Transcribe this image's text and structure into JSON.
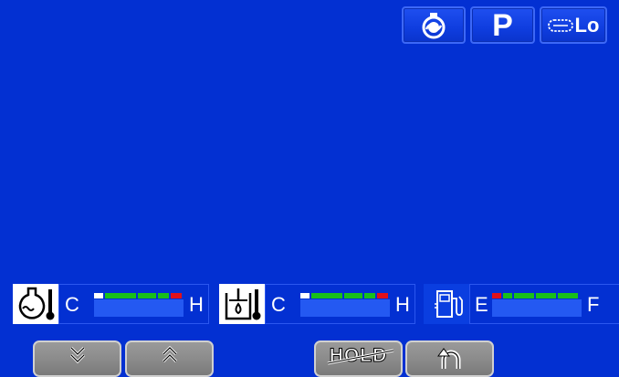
{
  "top_buttons": {
    "engine_icon": "engine-icon",
    "parking_label": "P",
    "track_speed_label": "Lo",
    "track_icon": "track-icon"
  },
  "gauges": [
    {
      "id": "coolant-temp",
      "icon": "coolant-temperature-icon",
      "low_label": "C",
      "high_label": "H",
      "level": 0
    },
    {
      "id": "hydraulic-oil-temp",
      "icon": "hydraulic-oil-temperature-icon",
      "low_label": "C",
      "high_label": "H",
      "level": 0
    },
    {
      "id": "fuel",
      "icon": "fuel-pump-icon",
      "low_label": "E",
      "high_label": "F",
      "level": 0
    }
  ],
  "colors": {
    "background": "#0330d2",
    "segment_white": "#ffffff",
    "segment_green": "#18c01a",
    "segment_red": "#e0101a"
  },
  "bottom_buttons": {
    "scroll_down_icon": "double-chevron-down-icon",
    "scroll_up_icon": "double-chevron-up-icon",
    "hold_label": "HOLD",
    "back_icon": "return-arrow-icon"
  }
}
